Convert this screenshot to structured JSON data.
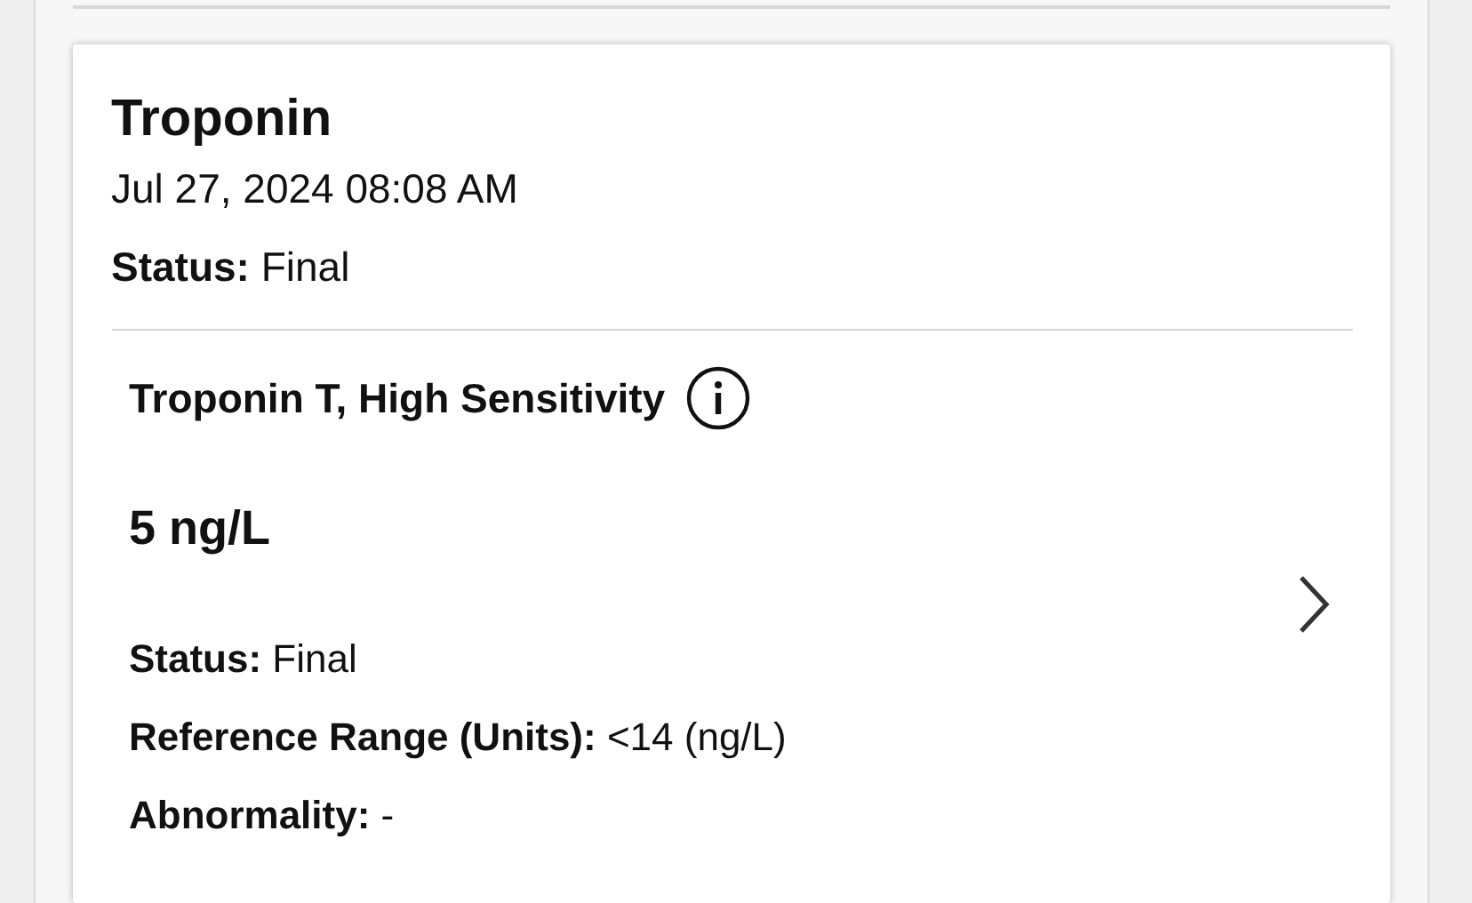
{
  "result_card": {
    "title": "Troponin",
    "date": "Jul 27, 2024 08:08 AM",
    "status": "**Status:** Final",
    "test": {
      "name": "Troponin T, High Sensitivity",
      "value": "5 ng/L",
      "details": [
        "**Status:** Final",
        "**Reference Range (Units):** <14 (ng/L)",
        "**Abnormality:** -"
      ]
    }
  }
}
